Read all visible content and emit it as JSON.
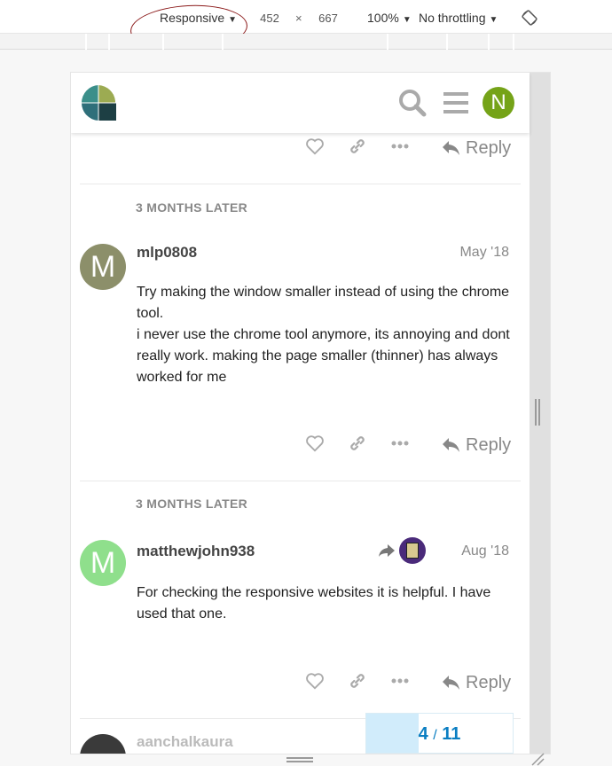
{
  "devtools": {
    "device": "Responsive",
    "width": "452",
    "times": "×",
    "height": "667",
    "zoom": "100%",
    "throttling": "No throttling"
  },
  "header": {
    "avatar_letter": "N",
    "avatar_color": "#75a318"
  },
  "posts": [
    {
      "time_gap": "3 MONTHS LATER",
      "avatar_letter": "M",
      "avatar_color": "#8c8f6a",
      "username": "mlp0808",
      "date": "May '18",
      "body": [
        "Try making the window smaller instead of using the chrome tool.",
        "i never use the chrome tool anymore, its annoying and dont really work. making the page smaller (thinner) has always worked for me"
      ]
    },
    {
      "time_gap": "3 MONTHS LATER",
      "avatar_letter": "M",
      "avatar_color": "#8fdf8c",
      "username": "matthewjohn938",
      "date": "Aug '18",
      "body": [
        "For checking the responsive websites it is helpful. I have used that one."
      ]
    },
    {
      "username": "aanchalkaura"
    }
  ],
  "actions": {
    "reply_label": "Reply"
  },
  "progress": {
    "current": "4",
    "separator": "/",
    "total": "11",
    "fill_fraction": 0.36
  },
  "colors": {
    "accent": "#0a7ec2",
    "annotation": "#8b1a1a"
  }
}
